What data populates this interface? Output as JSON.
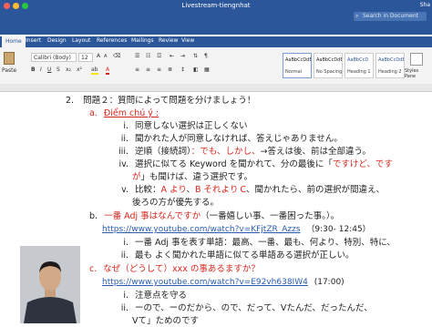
{
  "window": {
    "title": "Livestream-tiengnhat",
    "search_placeholder": "Search in Document",
    "share_label": "Sha"
  },
  "menu": {
    "tabs": [
      "Home",
      "Insert",
      "Design",
      "Layout",
      "References",
      "Mailings",
      "Review",
      "View"
    ]
  },
  "ribbon": {
    "paste_label": "Paste",
    "font_name": "Calibri (Body)",
    "font_size": "12",
    "styles": [
      {
        "sample": "AaBbCcDdEe",
        "name": "Normal"
      },
      {
        "sample": "AaBbCcDdEe",
        "name": "No Spacing"
      },
      {
        "sample": "AaBbCcD",
        "name": "Heading 1"
      },
      {
        "sample": "AaBbCcDdE",
        "name": "Heading 2"
      }
    ],
    "styles_pane_label": "Styles Pane"
  },
  "doc": {
    "l1": {
      "num": "2.",
      "text": "問題２：質問によって問題を分けましょう！"
    },
    "l2": {
      "num": "a.",
      "text": "Điểm chú ý :"
    },
    "l3": {
      "num": "i.",
      "text": "同意しない選択は正しくない"
    },
    "l4": {
      "num": "ii.",
      "text": "聞かれた人が同意しなければ、答えじゃありません。"
    },
    "l5": {
      "num": "iii.",
      "pre": "逆順（接続詞）",
      "red": "：でも、しかし、",
      "post": "→答えは後、前は全部違う。"
    },
    "l6": {
      "num": "iv.",
      "pre": "選択に似てる Keyword を聞かれて、分の最後に「",
      "red": "ですけど、です",
      "post": ""
    },
    "l7": {
      "red": "が",
      "post": "」も聞けば、違う選択です。"
    },
    "l8": {
      "num": "v.",
      "pre": "比較：",
      "a": "A より",
      "sep": "、",
      "b": "B それより",
      "c": "C",
      "post": "、聞かれたら、前の選択が間違え、"
    },
    "l9": {
      "text": "後ろの方が優先する。"
    },
    "l10": {
      "num": "b.",
      "red": "一番 Adj 事はなんですか",
      "post": "（一番嬉しい事、一番困った事。）。"
    },
    "l11": {
      "link": "https://www.youtube.com/watch?v=KFjtZR_Azzs",
      "time": "（9:30- 12:45）"
    },
    "l12": {
      "num": "i.",
      "text": "一番 Adj 事を表す単語：最高、一番、最も、何より、特別、特に、"
    },
    "l13": {
      "num": "ii.",
      "text": "最も よく聞かれた単語に似てる単語ある選択が正しい。"
    },
    "l14": {
      "num": "c.",
      "text": "なぜ（どうして）xxx の事あるますか？"
    },
    "l15": {
      "link": "https://www.youtube.com/watch?v=E92vh638IW4",
      "time": "(17:00)"
    },
    "l16": {
      "num": "i.",
      "text": "注意点を守る"
    },
    "l17": {
      "num": "ii.",
      "text": "ーので、ーのだから、ので、だって、Vたんだ、だったんだ、"
    },
    "l18": {
      "text": "Vて」ためのです"
    }
  }
}
